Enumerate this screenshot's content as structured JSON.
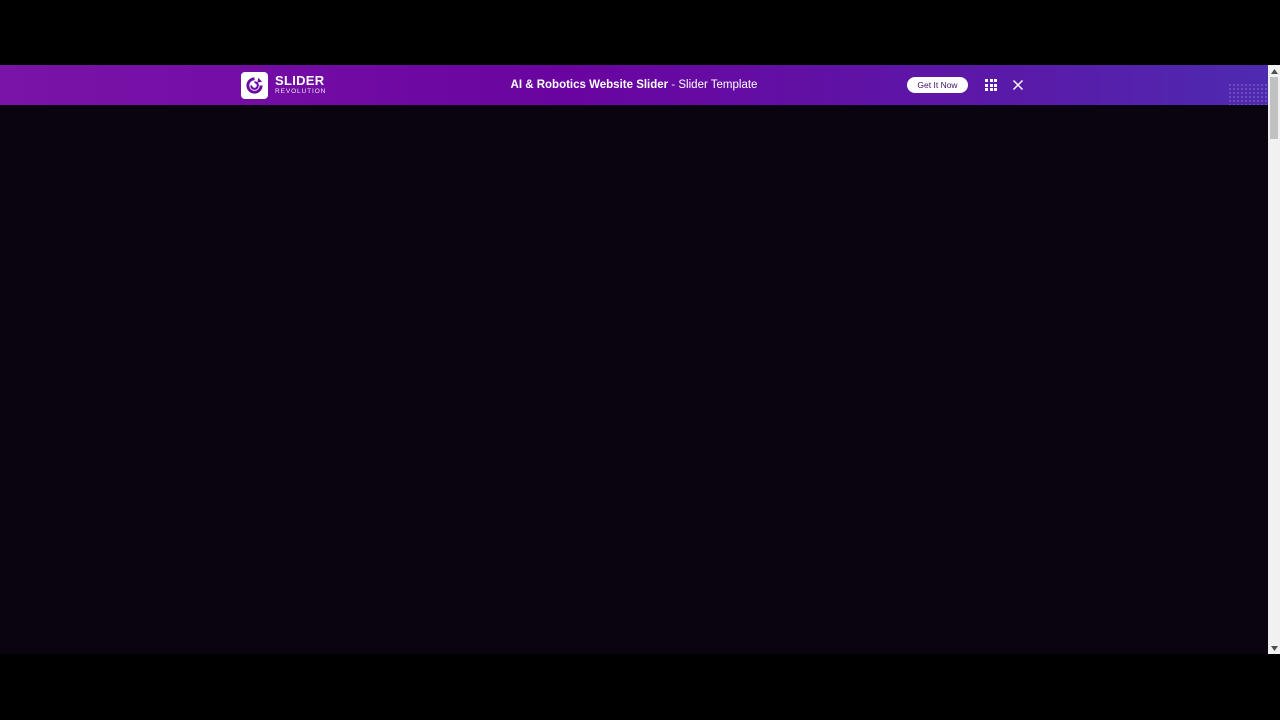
{
  "topbar": {
    "logo": {
      "word": "SLIDER",
      "sub": "REVOLUTION",
      "icon": "slider-revolution-logo-icon"
    },
    "title_strong": "AI & Robotics Website Slider",
    "title_separator": " - ",
    "title_rest": "Slider Template",
    "get_button_label": "Get It Now",
    "grid_icon": "grid-icon",
    "close_icon": "close-icon"
  },
  "colors": {
    "topbar_start": "#7a14a8",
    "topbar_end": "#4e2ab0",
    "page_background": "#0a0410",
    "letterbox": "#000000"
  }
}
